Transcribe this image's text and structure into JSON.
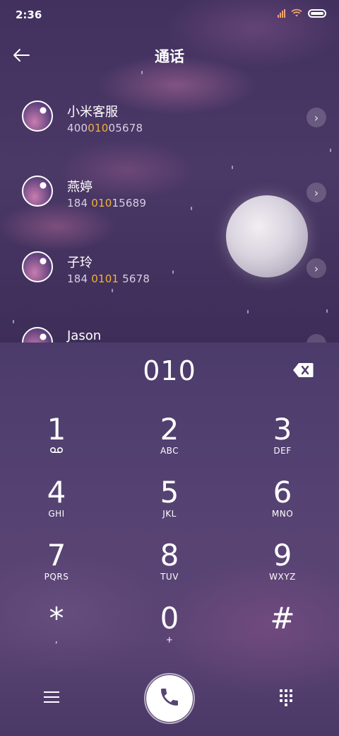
{
  "status_bar": {
    "time": "2:36"
  },
  "header": {
    "title": "通话"
  },
  "results": [
    {
      "name": "小米客服",
      "number_parts": [
        "400",
        "010",
        "05678"
      ]
    },
    {
      "name": "燕婷",
      "number_parts": [
        "184 ",
        "010",
        "15689"
      ]
    },
    {
      "name": "子玲",
      "number_parts": [
        "184 ",
        "0101",
        " 5678"
      ]
    },
    {
      "name": "Jason",
      "number_parts": [
        "",
        "",
        ""
      ]
    }
  ],
  "dialer": {
    "input": "010",
    "keys": [
      {
        "digit": "1",
        "letters": ""
      },
      {
        "digit": "2",
        "letters": "ABC"
      },
      {
        "digit": "3",
        "letters": "DEF"
      },
      {
        "digit": "4",
        "letters": "GHI"
      },
      {
        "digit": "5",
        "letters": "JKL"
      },
      {
        "digit": "6",
        "letters": "MNO"
      },
      {
        "digit": "7",
        "letters": "PQRS"
      },
      {
        "digit": "8",
        "letters": "TUV"
      },
      {
        "digit": "9",
        "letters": "WXYZ"
      },
      {
        "digit": "*",
        "letters": ","
      },
      {
        "digit": "0",
        "letters": "+"
      },
      {
        "digit": "#",
        "letters": ""
      }
    ]
  },
  "colors": {
    "highlight": "#f2b23b",
    "status_icons": "#f1a36b"
  },
  "icons": [
    "back-arrow-icon",
    "chevron-right-icon",
    "backspace-icon",
    "voicemail-icon",
    "menu-icon",
    "phone-icon",
    "dialpad-icon"
  ]
}
